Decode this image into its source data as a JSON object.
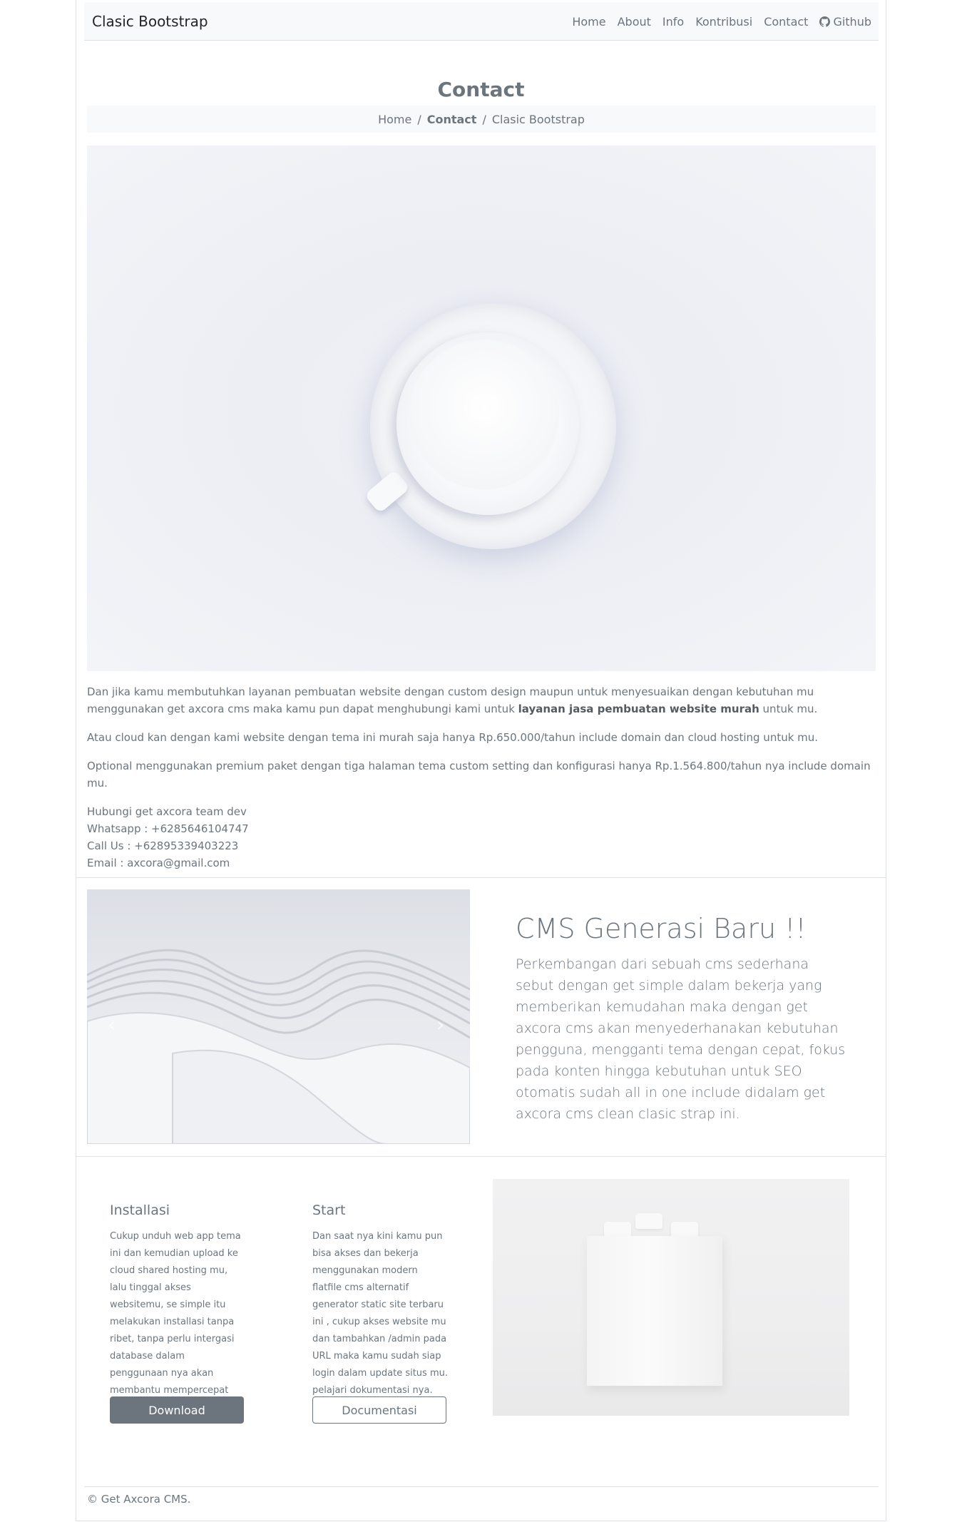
{
  "navbar": {
    "brand": "Clasic Bootstrap",
    "links": [
      "Home",
      "About",
      "Info",
      "Kontribusi",
      "Contact",
      "Github"
    ],
    "github_icon": "github-icon"
  },
  "page": {
    "title": "Contact"
  },
  "breadcrumb": {
    "items": [
      "Home",
      "Contact",
      "Clasic Bootstrap"
    ],
    "separator": "/"
  },
  "content": {
    "p1_start": "Dan jika kamu membutuhkan layanan pembuatan website dengan custom design maupun untuk menyesuaikan dengan kebutuhan mu menggunakan get axcora cms maka kamu pun dapat menghubungi kami untuk ",
    "p1_bold": "layanan jasa pembuatan website murah",
    "p1_end": " untuk mu.",
    "p2": "Atau cloud kan dengan kami website dengan tema ini murah saja hanya Rp.650.000/tahun include domain dan cloud hosting untuk mu.",
    "p3": "Optional menggunakan premium paket dengan tiga halaman tema custom setting dan konfigurasi hanya Rp.1.564.800/tahun nya include domain mu.",
    "contact_heading": "Hubungi get axcora team dev",
    "whatsapp": "Whatsapp : +6285646104747",
    "call": "Call Us : +62895339403223",
    "email": "Email : axcora@gmail.com"
  },
  "promo": {
    "title": "CMS Generasi Baru !!",
    "body": "Perkembangan dari sebuah cms sederhana sebut dengan get simple dalam bekerja yang memberikan kemudahan maka dengan get axcora cms akan menyederhanakan kebutuhan pengguna, mengganti tema dengan cepat, fokus pada konten hingga kebutuhan untuk SEO otomatis sudah all in one include didalam get axcora cms clean clasic strap ini.",
    "prev_icon": "chevron-left-icon",
    "next_icon": "chevron-right-icon",
    "prev_glyph": "‹",
    "next_glyph": "›"
  },
  "features": [
    {
      "title": "Installasi",
      "text": "Cukup unduh web app tema ini dan kemudian upload ke cloud shared hosting mu, lalu tinggal akses websitemu, se simple itu melakukan installasi tanpa ribet, tanpa perlu intergasi database dalam penggunaan nya akan membantu mempercepat kinerja website mu.",
      "button": "Download"
    },
    {
      "title": "Start",
      "text": "Dan saat nya kini kamu pun bisa akses dan bekerja menggunakan modern flatfile cms alternatif generator static site terbaru ini , cukup akses website mu dan tambahkan /admin pada URL maka kamu sudah siap login dalam update situs mu. pelajari dokumentasi nya.",
      "button": "Documentasi"
    }
  ],
  "footer": {
    "text": "© Get Axcora CMS."
  }
}
